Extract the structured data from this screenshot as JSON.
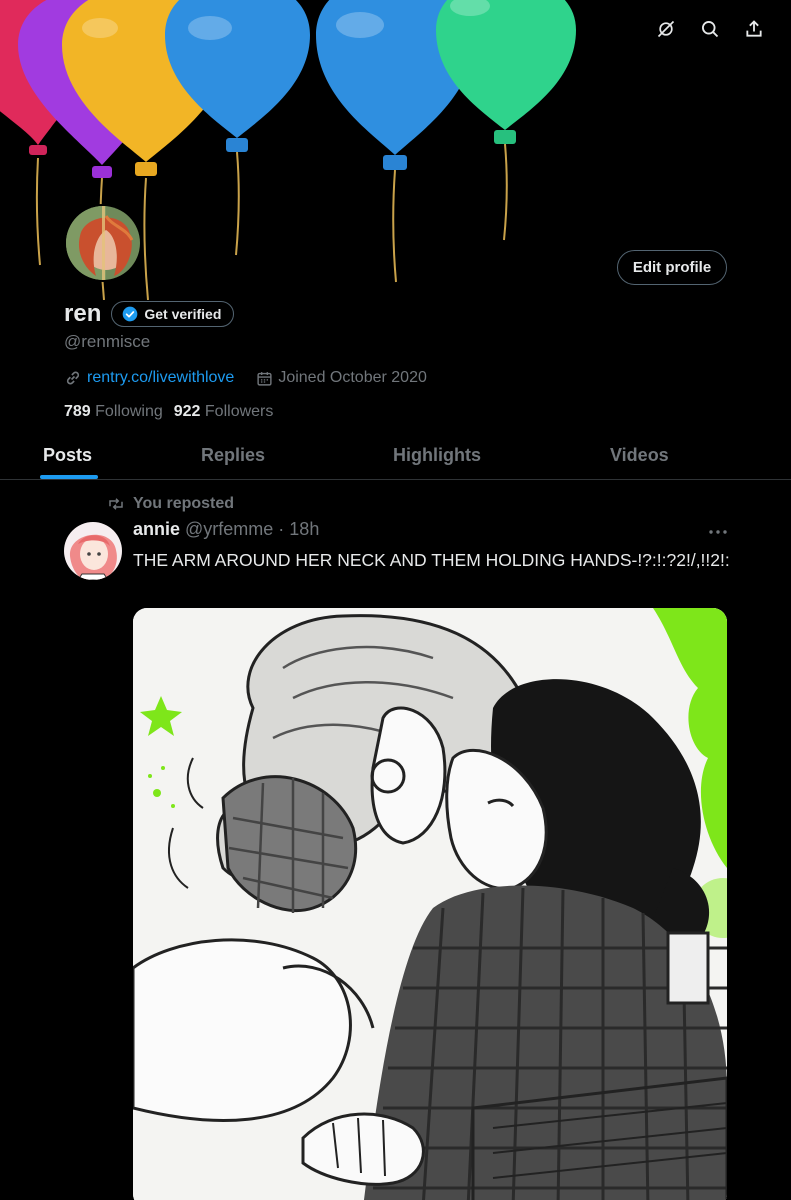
{
  "header_actions": [
    {
      "icon": "grok-icon"
    },
    {
      "icon": "search-icon"
    },
    {
      "icon": "share-icon"
    }
  ],
  "profile": {
    "name": "ren",
    "handle": "@renmisce",
    "verify_label": "Get verified",
    "edit_label": "Edit profile",
    "link": "rentry.co/livewithlove",
    "joined": "Joined October 2020",
    "following_count": "789",
    "following_label": "Following",
    "followers_count": "922",
    "followers_label": "Followers"
  },
  "tabs": [
    {
      "label": "Posts",
      "active": true
    },
    {
      "label": "Replies",
      "active": false
    },
    {
      "label": "Highlights",
      "active": false
    },
    {
      "label": "Videos",
      "active": false
    }
  ],
  "post": {
    "repost_label": "You reposted",
    "author_name": "annie",
    "author_handle": "@yrfemme",
    "separator": "·",
    "time": "18h",
    "text": "THE ARM AROUND HER NECK AND THEM HOLDING HANDS-!?:!:?2!/,!!2!:"
  },
  "colors": {
    "background": "#000000",
    "accent": "#1d9bf0",
    "muted": "#71767b",
    "text": "#e7e9ea",
    "border": "#2f3336"
  }
}
